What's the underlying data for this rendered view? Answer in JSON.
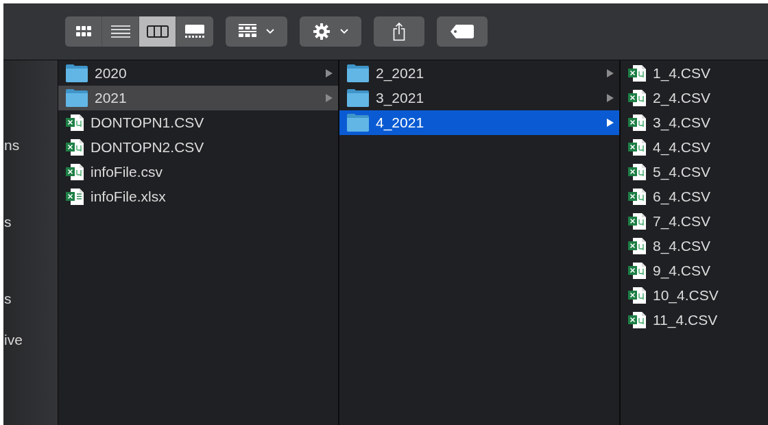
{
  "toolbar": {
    "view_modes": [
      {
        "kind": "icons",
        "selected": false
      },
      {
        "kind": "list",
        "selected": false
      },
      {
        "kind": "columns",
        "selected": true
      },
      {
        "kind": "gallery",
        "selected": false
      }
    ],
    "buttons": [
      {
        "kind": "group"
      },
      {
        "kind": "action"
      },
      {
        "kind": "share"
      },
      {
        "kind": "tag"
      }
    ]
  },
  "sidebar": {
    "items": [
      {
        "label": "ns"
      },
      {
        "label": "s"
      },
      {
        "label": "s"
      },
      {
        "label": "ive"
      }
    ]
  },
  "columns": [
    {
      "focused": false,
      "items": [
        {
          "name": "2020",
          "kind": "folder",
          "selected": false
        },
        {
          "name": "2021",
          "kind": "folder",
          "selected": true
        },
        {
          "name": "DONTOPN1.CSV",
          "kind": "csv",
          "selected": false
        },
        {
          "name": "DONTOPN2.CSV",
          "kind": "csv",
          "selected": false
        },
        {
          "name": "infoFile.csv",
          "kind": "csv",
          "selected": false
        },
        {
          "name": "infoFile.xlsx",
          "kind": "xlsx",
          "selected": false
        }
      ]
    },
    {
      "focused": true,
      "items": [
        {
          "name": "2_2021",
          "kind": "folder",
          "selected": false
        },
        {
          "name": "3_2021",
          "kind": "folder",
          "selected": false
        },
        {
          "name": "4_2021",
          "kind": "folder",
          "selected": true
        }
      ]
    },
    {
      "items": [
        {
          "name": "1_4.CSV",
          "kind": "csv",
          "selected": false
        },
        {
          "name": "2_4.CSV",
          "kind": "csv",
          "selected": false
        },
        {
          "name": "3_4.CSV",
          "kind": "csv",
          "selected": false
        },
        {
          "name": "4_4.CSV",
          "kind": "csv",
          "selected": false
        },
        {
          "name": "5_4.CSV",
          "kind": "csv",
          "selected": false
        },
        {
          "name": "6_4.CSV",
          "kind": "csv",
          "selected": false
        },
        {
          "name": "7_4.CSV",
          "kind": "csv",
          "selected": false
        },
        {
          "name": "8_4.CSV",
          "kind": "csv",
          "selected": false
        },
        {
          "name": "9_4.CSV",
          "kind": "csv",
          "selected": false
        },
        {
          "name": "10_4.CSV",
          "kind": "csv",
          "selected": false
        },
        {
          "name": "11_4.CSV",
          "kind": "csv",
          "selected": false
        }
      ]
    }
  ]
}
